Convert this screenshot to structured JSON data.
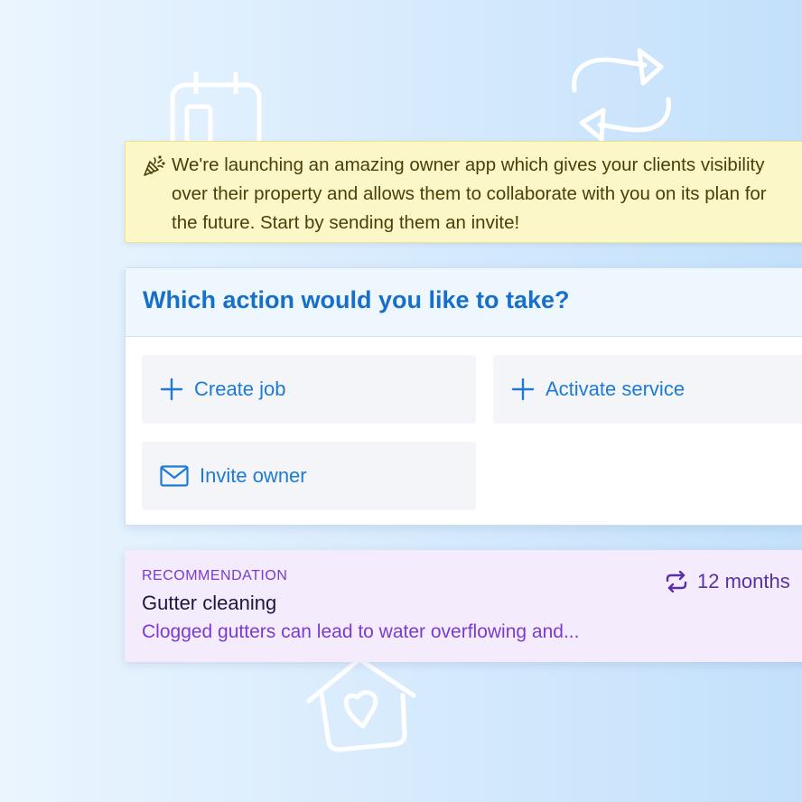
{
  "notice": {
    "icon": "party-popper-icon",
    "text": "We're launching an amazing owner app which gives your clients visibility over their property and allows them to collaborate with you on its plan for the future. Start by sending them an invite!"
  },
  "actions": {
    "title": "Which action would you like to take?",
    "items": [
      {
        "label": "Create job",
        "icon": "plus-icon"
      },
      {
        "label": "Activate service",
        "icon": "plus-icon"
      },
      {
        "label": "Invite owner",
        "icon": "envelope-icon"
      }
    ]
  },
  "recommendation": {
    "tag": "RECOMMENDATION",
    "title": "Gutter cleaning",
    "description": "Clogged gutters can lead to water overflowing and...",
    "frequency": "12 months",
    "frequency_icon": "repeat-icon"
  },
  "colors": {
    "accent_blue": "#1670c9",
    "notice_bg": "#fbf7c9",
    "recommendation_bg": "#f4ecfd",
    "recommendation_accent": "#7a3bd1"
  }
}
